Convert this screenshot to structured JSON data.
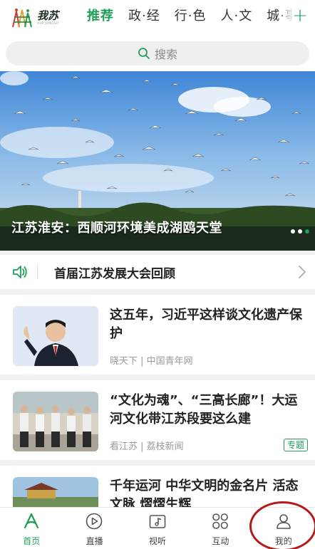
{
  "header": {
    "logo_name": "我苏",
    "logo_sub": "OUR JIANGSU",
    "tabs": [
      {
        "label": "推荐",
        "active": true
      },
      {
        "label": "政·经",
        "active": false
      },
      {
        "label": "行·色",
        "active": false
      },
      {
        "label": "人·文",
        "active": false
      },
      {
        "label": "城·事",
        "active": false
      }
    ],
    "add_icon": "plus-icon"
  },
  "search": {
    "placeholder": "搜索",
    "icon": "search-icon"
  },
  "banner": {
    "caption": "江苏淮安：西顺河环境美成湖鸥天堂",
    "slide_count": 3,
    "active_slide": 1
  },
  "notice": {
    "text": "首届江苏发展大会回顾",
    "icon": "speaker-icon"
  },
  "news": [
    {
      "title": "这五年，习近平这样谈文化遗产保护",
      "source": "晓天下 | 中国青年网",
      "tag": ""
    },
    {
      "title": "“文化为魂”、“三高长廊”！大运河文化带江苏段要这么建",
      "source": "看江苏 | 荔枝新闻",
      "tag": "专题"
    },
    {
      "title": "千年运河 中华文明的金名片 活态文脉 熠熠生辉",
      "source": "",
      "tag": ""
    }
  ],
  "bottom_nav": [
    {
      "label": "首页",
      "icon": "home-icon",
      "active": true
    },
    {
      "label": "直播",
      "icon": "play-icon",
      "active": false
    },
    {
      "label": "视听",
      "icon": "music-video-icon",
      "active": false
    },
    {
      "label": "互动",
      "icon": "interact-icon",
      "active": false
    },
    {
      "label": "我的",
      "icon": "user-icon",
      "active": false
    }
  ],
  "colors": {
    "accent": "#1f9e57",
    "indicator": "#e2463a",
    "highlight_circle": "#b51a1a"
  }
}
